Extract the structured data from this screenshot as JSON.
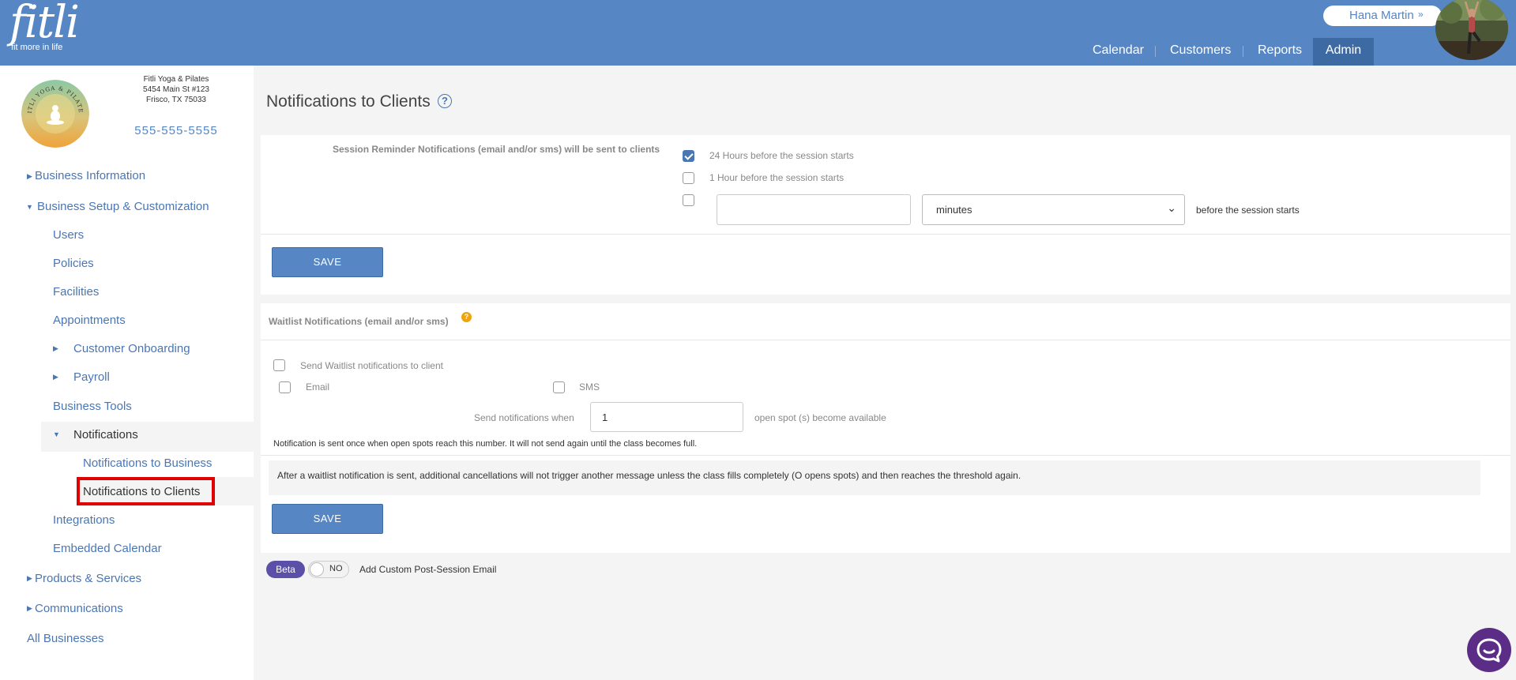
{
  "brand": {
    "logo_word": "fitli",
    "logo_tagline": "fit more in life"
  },
  "header": {
    "user_name": "Hana Martin",
    "nav": [
      {
        "label": "Calendar"
      },
      {
        "label": "Customers"
      },
      {
        "label": "Reports"
      },
      {
        "label": "Admin",
        "active": true
      }
    ]
  },
  "business": {
    "name": "Fitli Yoga & Pilates",
    "address_line1": "5454 Main St #123",
    "address_line2": "Frisco, TX 75033",
    "phone": "555-555-5555",
    "logo_text": "FITLI YOGA & PILATES"
  },
  "sidebar": {
    "business_information": "Business Information",
    "business_setup": "Business Setup & Customization",
    "users": "Users",
    "policies": "Policies",
    "facilities": "Facilities",
    "appointments": "Appointments",
    "customer_onboarding": "Customer Onboarding",
    "payroll": "Payroll",
    "business_tools": "Business Tools",
    "notifications": "Notifications",
    "notifications_to_business": "Notifications to Business",
    "notifications_to_clients": "Notifications to Clients",
    "integrations": "Integrations",
    "embedded_calendar": "Embedded Calendar",
    "products_services": "Products & Services",
    "communications": "Communications",
    "all_businesses": "All Businesses"
  },
  "main": {
    "title": "Notifications to Clients",
    "reminders": {
      "label": "Session Reminder Notifications (email and/or sms) will be sent to clients",
      "option_24h": "24 Hours before the session starts",
      "option_24h_checked": true,
      "option_1h": "1 Hour before the session starts",
      "option_1h_checked": false,
      "custom_checked": false,
      "custom_value": "",
      "custom_unit": "minutes",
      "custom_suffix": "before the session starts",
      "save": "SAVE"
    },
    "waitlist": {
      "heading": "Waitlist Notifications (email and/or sms)",
      "send_label": "Send Waitlist notifications to client",
      "email_label": "Email",
      "sms_label": "SMS",
      "when_label": "Send notifications when",
      "when_value": "1",
      "when_suffix": "open spot (s) become available",
      "note": "Notification is sent once when open spots reach this number. It will not send again until the class becomes full.",
      "info": "After a waitlist notification is sent, additional cancellations will not trigger another message unless the class fills completely (O opens spots) and then reaches the threshold again.",
      "save": "SAVE"
    },
    "post_session": {
      "beta": "Beta",
      "toggle": "NO",
      "label": "Add Custom Post-Session Email"
    }
  },
  "colors": {
    "header_bg": "#5686c4",
    "admin_active": "#3e6aa3",
    "link": "#4a76b4",
    "highlight_box": "#e00000",
    "beta": "#5b4fa8",
    "chat": "#5b2d86",
    "info": "#f0a30a"
  },
  "icons": {
    "help": "question-circle-icon",
    "info": "info-circle-icon",
    "chat": "chat-bubble-icon",
    "user_menu": "double-chevron-down-icon"
  }
}
